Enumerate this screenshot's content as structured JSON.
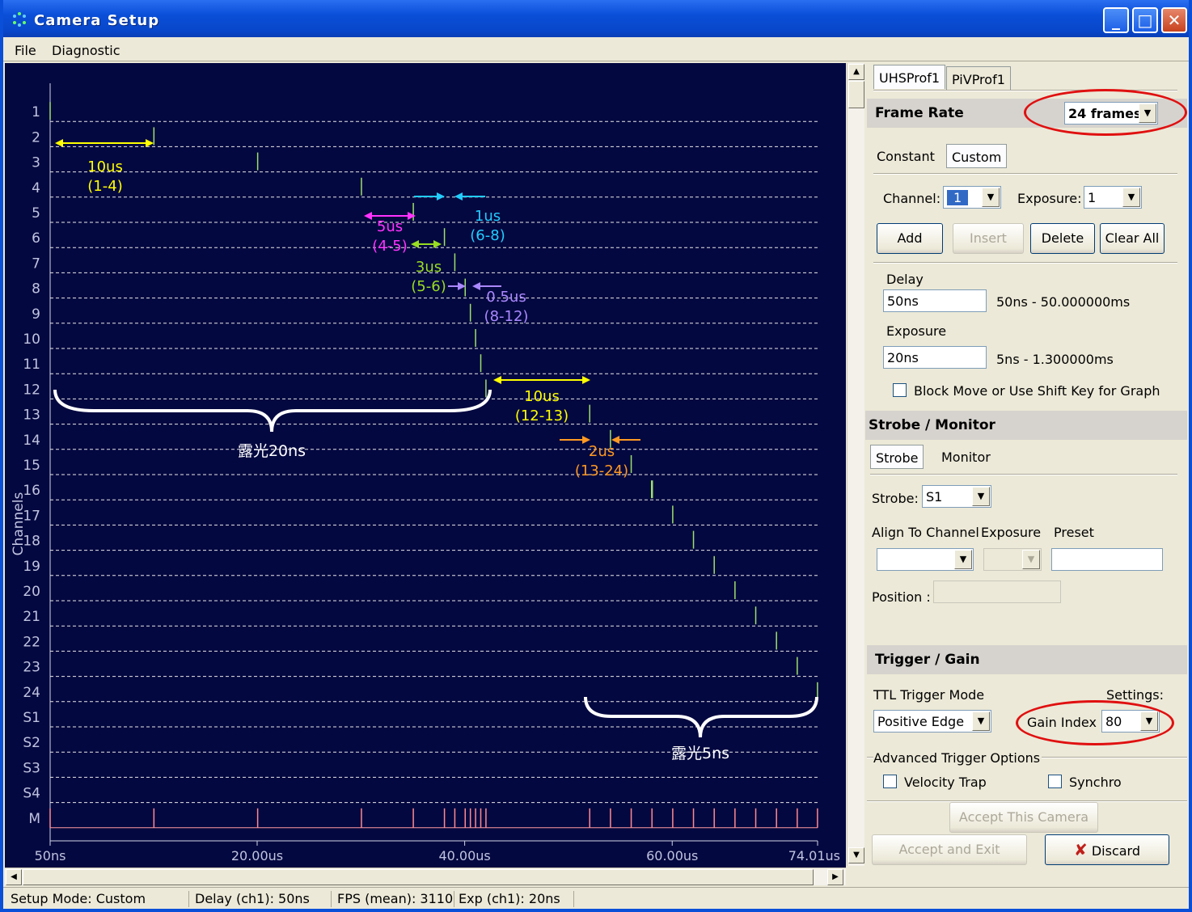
{
  "window": {
    "title": "Camera Setup",
    "minimize": "_",
    "maximize": "□",
    "close": "✕"
  },
  "menu": [
    "File",
    "Diagnostic"
  ],
  "chart_data": {
    "type": "timing-diagram",
    "ylabel": "Channels",
    "channels": [
      "1",
      "2",
      "3",
      "4",
      "5",
      "6",
      "7",
      "8",
      "9",
      "10",
      "11",
      "12",
      "13",
      "14",
      "15",
      "16",
      "17",
      "18",
      "19",
      "20",
      "21",
      "22",
      "23",
      "24",
      "S1",
      "S2",
      "S3",
      "S4",
      "M"
    ],
    "pulse_times_us": [
      0.05,
      10.05,
      20.05,
      30.05,
      35.05,
      38.05,
      39.05,
      40.05,
      40.55,
      41.05,
      41.55,
      42.05,
      52.05,
      54.05,
      56.05,
      58.05,
      60.05,
      62.05,
      64.05,
      66.05,
      68.05,
      70.05,
      72.05,
      74.0
    ],
    "xlim": [
      0.05,
      74.01
    ],
    "x_tick_values": [
      0.05,
      20,
      40,
      60,
      74.01
    ],
    "x_tick_labels": [
      "50ns",
      "20.00us",
      "40.00us",
      "60.00us",
      "74.01us"
    ],
    "annotations": [
      {
        "text": "10us",
        "sub": "(1-4)",
        "color": "#ffff00"
      },
      {
        "text": "5us",
        "sub": "(4-5)",
        "color": "#ff33ff"
      },
      {
        "text": "1us",
        "sub": "(6-8)",
        "color": "#22ccff"
      },
      {
        "text": "3us",
        "sub": "(5-6)",
        "color": "#99dd22"
      },
      {
        "text": "0.5us",
        "sub": "(8-12)",
        "color": "#aa88ff"
      },
      {
        "text": "10us",
        "sub": "(12-13)",
        "color": "#ffff00"
      },
      {
        "text": "2us",
        "sub": "(13-24)",
        "color": "#ff9922"
      },
      {
        "text": "露光20ns",
        "color": "#ffffff"
      },
      {
        "text": "露光5ns",
        "color": "#ffffff"
      }
    ]
  },
  "panel": {
    "tabs": [
      "UHSProf1",
      "PiVProf1"
    ],
    "frame_rate": {
      "label": "Frame Rate",
      "value": "24 frames"
    },
    "mode_tabs": [
      "Constant",
      "Custom"
    ],
    "channel": {
      "label": "Channel:",
      "value": "1"
    },
    "exposure_sel": {
      "label": "Exposure:",
      "value": "1"
    },
    "buttons": {
      "add": "Add",
      "insert": "Insert",
      "delete": "Delete",
      "clear_all": "Clear All"
    },
    "delay": {
      "label": "Delay",
      "value": "50ns",
      "range": "50ns - 50.000000ms"
    },
    "exposure": {
      "label": "Exposure",
      "value": "20ns",
      "range": "5ns - 1.300000ms"
    },
    "block_move": "Block Move or Use Shift Key for Graph",
    "strobe_monitor": {
      "title": "Strobe / Monitor",
      "tabs": [
        "Strobe",
        "Monitor"
      ],
      "strobe_label": "Strobe:",
      "strobe_value": "S1",
      "align_label": "Align To Channel",
      "exposure_label": "Exposure",
      "preset_label": "Preset",
      "position_label": "Position :"
    },
    "trigger_gain": {
      "title": "Trigger / Gain",
      "ttl_label": "TTL Trigger Mode",
      "settings_label": "Settings:",
      "ttl_value": "Positive Edge",
      "gain_label": "Gain Index :",
      "gain_value": "80"
    },
    "advanced": {
      "title": "Advanced Trigger Options",
      "velocity": "Velocity Trap",
      "synchro": "Synchro"
    },
    "footer": {
      "accept": "Accept This Camera",
      "accept_exit": "Accept and  Exit",
      "discard": "Discard"
    }
  },
  "status": [
    "Setup Mode: Custom",
    "Delay (ch1): 50ns",
    "FPS (mean): 3110",
    "Exp (ch1): 20ns"
  ]
}
